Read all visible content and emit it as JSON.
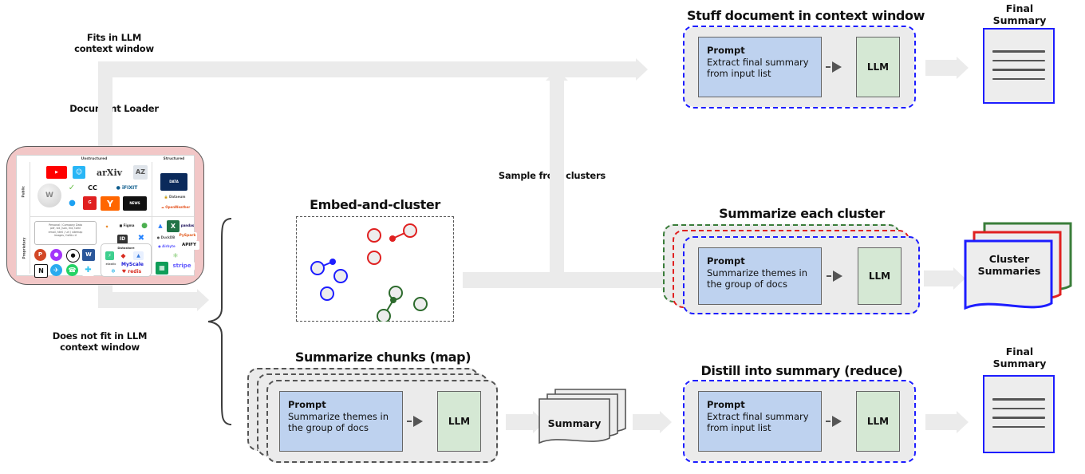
{
  "flow_labels": {
    "fits": "Fits in LLM\ncontext window",
    "fits_line1": "Fits in LLM",
    "fits_line2": "context window",
    "document_loader": "Document Loader",
    "not_fit_line1": "Does not fit in LLM",
    "not_fit_line2": "context window",
    "sample_from_clusters": "Sample from clusters"
  },
  "sections": {
    "stuff": {
      "title": "Stuff document in context window",
      "prompt_title": "Prompt",
      "prompt_body_line1": "Extract final summary",
      "prompt_body_line2": "from input list",
      "llm": "LLM"
    },
    "cluster": {
      "title": "Summarize each cluster",
      "prompt_title": "Prompt",
      "prompt_body_line1": "Summarize themes in",
      "prompt_body_line2": "the group of docs",
      "llm": "LLM",
      "border_colors": [
        "#3a7d3a",
        "#e02020",
        "#1d1dff"
      ]
    },
    "map": {
      "title": "Summarize chunks (map)",
      "prompt_title": "Prompt",
      "prompt_body_line1": "Summarize themes in",
      "prompt_body_line2": "the group of docs",
      "llm": "LLM"
    },
    "reduce": {
      "title": "Distill into summary (reduce)",
      "prompt_title": "Prompt",
      "prompt_body_line1": "Extract final summary",
      "prompt_body_line2": "from input list",
      "llm": "LLM"
    },
    "embed": {
      "title": "Embed-and-cluster"
    }
  },
  "outputs": {
    "final_summary_top_line1": "Final",
    "final_summary_top_line2": "Summary",
    "final_summary_bottom_line1": "Final",
    "final_summary_bottom_line2": "Summary",
    "cluster_summaries_line1": "Cluster",
    "cluster_summaries_line2": "Summaries",
    "summary": "Summary"
  },
  "loader": {
    "col_headers": [
      "Unstructured",
      "Structured"
    ],
    "row_headers": [
      "Public",
      "Proprietary"
    ],
    "note_lines": [
      "Personal / Company Data",
      "pdf, txt, json, md, toml",
      "email, html / url / sitemap",
      "images, CoNLL-U"
    ],
    "datastore_title": "Datastore",
    "logos_public_unstructured": [
      "YouTube",
      "Chat",
      "arXiv",
      "AZ",
      "Wikipedia",
      "Evernote",
      "CC",
      "iFixit",
      "Twitter",
      "G",
      "Y",
      "News"
    ],
    "logos_public_structured": [
      "Dataset",
      "Dataeum",
      "OpenWeather"
    ],
    "logos_proprietary_unstructured": [
      "Slack",
      "Figma",
      "Evernote",
      "PowerPoint",
      "Messenger",
      "GitHub",
      "Word",
      "Notion",
      "Telegram",
      "WhatsApp",
      "Slack2",
      "Airtable",
      "Atlassian"
    ],
    "logos_proprietary_structured": [
      "Airtable",
      "Excel",
      "pandas",
      "DuckDB",
      "PySpark",
      "Airbyte",
      "APIFY",
      "Anaconda",
      "stripe",
      "Airtable2"
    ],
    "datastore_logos": [
      "Supabase",
      "Redis",
      "Atlas",
      "Elastic",
      "MyScale",
      "Snowflake",
      "redis"
    ]
  },
  "chart_data": {
    "type": "scatter",
    "title": "Embed-and-cluster",
    "grid": false,
    "legend": "none",
    "xlim": [
      0,
      100
    ],
    "ylim": [
      0,
      100
    ],
    "series": [
      {
        "name": "cluster-red",
        "color": "#e02020",
        "points": [
          [
            49,
            82
          ],
          [
            72,
            87
          ],
          [
            49,
            61
          ]
        ],
        "centroid": [
          61,
          79
        ]
      },
      {
        "name": "cluster-blue",
        "color": "#1d1dff",
        "points": [
          [
            13,
            51
          ],
          [
            28,
            43
          ],
          [
            19,
            27
          ]
        ],
        "centroid": [
          23,
          57
        ]
      },
      {
        "name": "cluster-green",
        "color": "#2d6b2d",
        "points": [
          [
            63,
            28
          ],
          [
            79,
            17
          ],
          [
            58,
            5
          ]
        ],
        "centroid": [
          62,
          17
        ]
      }
    ]
  }
}
